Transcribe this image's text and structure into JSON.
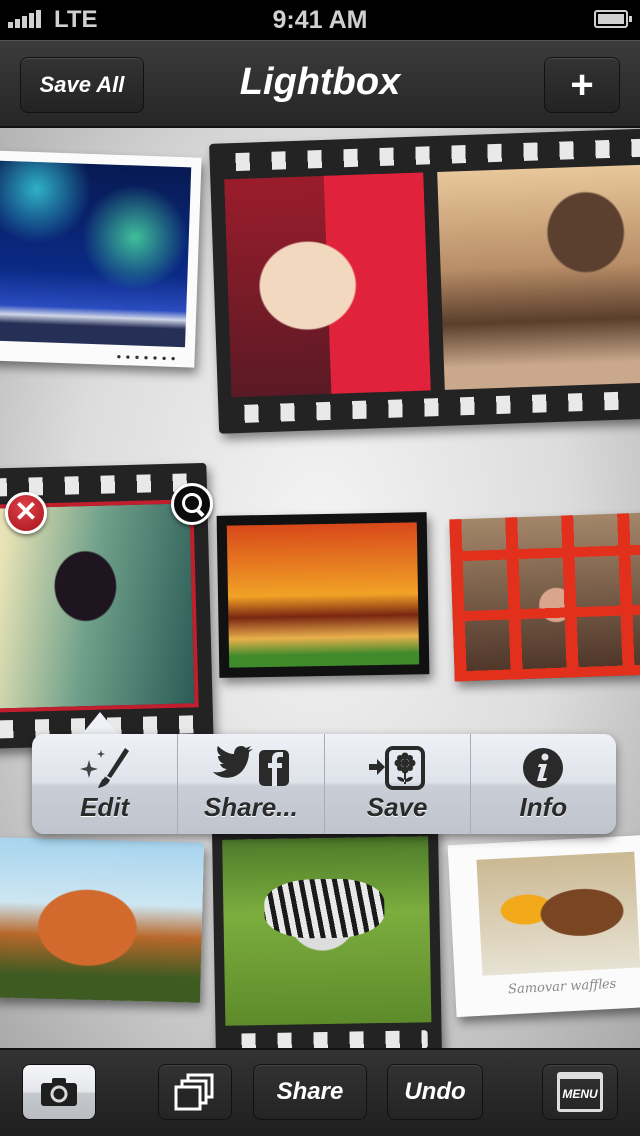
{
  "status_bar": {
    "signal_bars": 5,
    "carrier": "LTE",
    "time": "9:41 AM",
    "battery_level": 1.0
  },
  "nav": {
    "left_button": "Save All",
    "title": "Lightbox",
    "right_button": "+"
  },
  "photos": [
    {
      "subject": "concert",
      "style": "polaroid"
    },
    {
      "subject": "venetian mask",
      "style": "filmstrip"
    },
    {
      "subject": "venice skyline",
      "style": "filmstrip"
    },
    {
      "subject": "street lamp",
      "style": "filmstrip",
      "selected": true
    },
    {
      "subject": "temple",
      "style": "black frame"
    },
    {
      "subject": "phone booth",
      "style": "plain"
    },
    {
      "subject": "palace of fine arts",
      "style": "plain"
    },
    {
      "subject": "zebra",
      "style": "filmstrip"
    },
    {
      "subject": "waffles",
      "style": "postcard",
      "caption": "Samovar waffles"
    }
  ],
  "selection": {
    "delete_icon": "✕",
    "zoom_icon": "magnifier"
  },
  "popover": {
    "items": [
      {
        "label": "Edit",
        "icon": "magic-brush"
      },
      {
        "label": "Share...",
        "icon": "twitter-facebook"
      },
      {
        "label": "Save",
        "icon": "save-to-photos"
      },
      {
        "label": "Info",
        "icon": "info"
      }
    ]
  },
  "toolbar": {
    "camera": "camera-icon",
    "layers": "layers-icon",
    "share_label": "Share",
    "undo_label": "Undo",
    "menu_label": "MENU"
  },
  "colors": {
    "selection_frame": "#c21f2e",
    "delete_button": "#c0202a",
    "bar_background": "#2b2b2b"
  }
}
